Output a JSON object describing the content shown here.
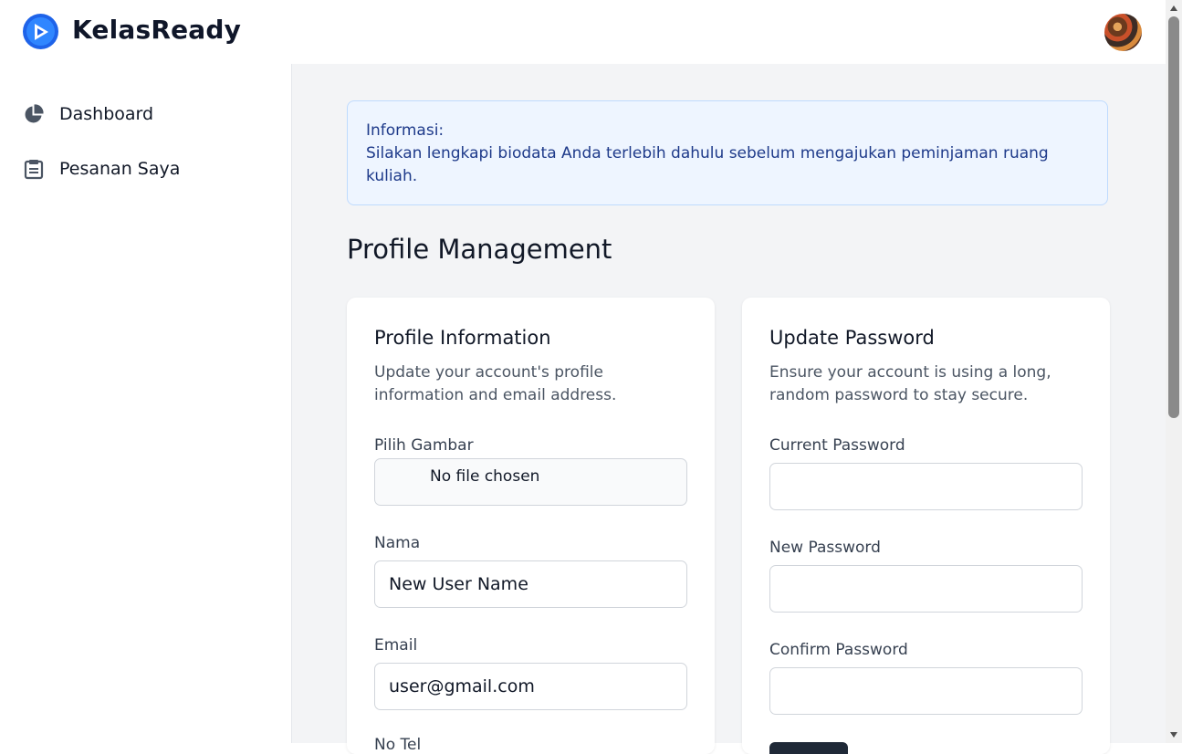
{
  "app": {
    "name": "KelasReady"
  },
  "sidebar": {
    "items": [
      {
        "label": "Dashboard",
        "icon": "pie-chart-icon"
      },
      {
        "label": "Pesanan Saya",
        "icon": "clipboard-icon"
      }
    ]
  },
  "alert": {
    "title": "Informasi:",
    "message": "Silakan lengkapi biodata Anda terlebih dahulu sebelum mengajukan peminjaman ruang kuliah."
  },
  "page": {
    "title": "Profile Management"
  },
  "profile": {
    "title": "Profile Information",
    "description": "Update your account's profile information and email address.",
    "image_label": "Pilih Gambar",
    "file_status": "No file chosen",
    "name_label": "Nama",
    "name_value": "New User Name",
    "email_label": "Email",
    "email_value": "user@gmail.com",
    "next_label_partial": "No Tel"
  },
  "password": {
    "title": "Update Password",
    "description": "Ensure your account is using a long, random password to stay secure.",
    "current_label": "Current Password",
    "current_value": "",
    "new_label": "New Password",
    "new_value": "",
    "confirm_label": "Confirm Password",
    "confirm_value": ""
  },
  "colors": {
    "brand": "#1e63e9",
    "alert_bg": "#eef5ff",
    "alert_text": "#1e3a8a",
    "page_bg": "#f3f4f6",
    "button_dark": "#1f2937"
  }
}
